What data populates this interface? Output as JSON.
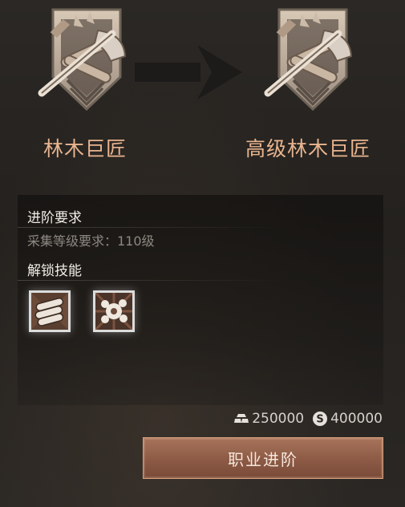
{
  "advancement": {
    "from_job": "林木巨匠",
    "to_job": "高级林木巨匠",
    "from_emblem_icon": "woodcutter-axe-emblem-icon",
    "to_emblem_icon": "woodcutter-axe-emblem-icon",
    "arrow_icon": "arrow-right-icon"
  },
  "requirements": {
    "title": "进阶要求",
    "gather_level_req": "采集等级要求：110级"
  },
  "skills": {
    "title": "解锁技能",
    "items": [
      {
        "icon": "log-bundle-icon"
      },
      {
        "icon": "wood-chips-burst-icon"
      }
    ]
  },
  "cost": {
    "materials_icon": "ingot-stack-icon",
    "materials_amount": "250000",
    "silver_icon": "silver-coin-icon",
    "silver_amount": "400000"
  },
  "action": {
    "button_label": "职业进阶"
  },
  "colors": {
    "accent": "#e8b48f",
    "button": "#9a664f",
    "panel": "#1a1816"
  }
}
